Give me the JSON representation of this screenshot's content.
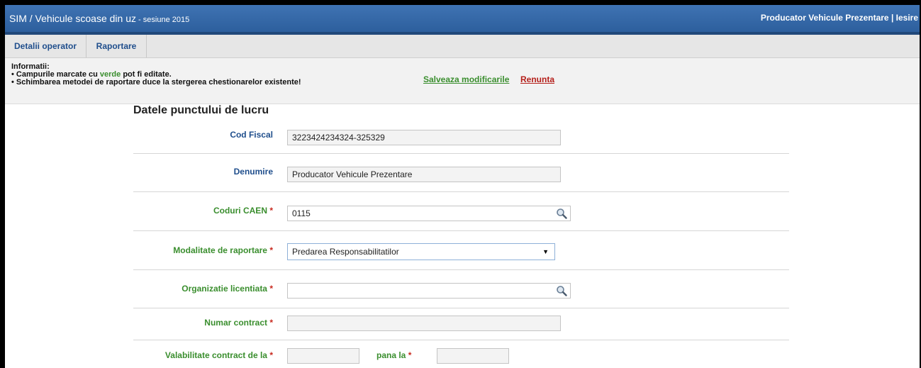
{
  "header": {
    "title": "SIM / Vehicule scoase din uz",
    "session": " - sesiune 2015",
    "user": "Producator Vehicule Prezentare",
    "separator": " | ",
    "logout": "Iesire"
  },
  "tabs": [
    {
      "label": "Detalii operator"
    },
    {
      "label": "Raportare"
    }
  ],
  "info": {
    "heading": "Informatii:",
    "line1_before": "• Campurile marcate cu ",
    "line1_green": "verde",
    "line1_after": " pot fi editate.",
    "line2": "• Schimbarea metodei de raportare duce la stergerea chestionarelor existente!",
    "save_label": "Salveaza modificarile",
    "cancel_label": "Renunta"
  },
  "form": {
    "section_title": "Datele punctului de lucru",
    "required_mark": "*",
    "cod_fiscal": {
      "label": "Cod Fiscal",
      "value": "3223424234324-325329"
    },
    "denumire": {
      "label": "Denumire",
      "value": "Producator Vehicule Prezentare"
    },
    "coduri_caen": {
      "label": "Coduri CAEN",
      "value": "0115"
    },
    "modalitate": {
      "label": "Modalitate de raportare",
      "value": "Predarea Responsabilitatilor"
    },
    "organizatie": {
      "label": "Organizatie licentiata",
      "value": ""
    },
    "numar_contract": {
      "label": "Numar contract",
      "value": ""
    },
    "valabilitate": {
      "label": "Valabilitate contract de la",
      "value": "",
      "pana_label": "pana la",
      "pana_value": ""
    }
  },
  "colors": {
    "header_bg": "#3a6cab",
    "editable_label": "#3a8e2e",
    "readonly_label": "#1f4e8c",
    "required": "#c8291e",
    "cancel": "#b5201b"
  },
  "icons": [
    "magnifier-icon",
    "dropdown-arrow-icon"
  ]
}
